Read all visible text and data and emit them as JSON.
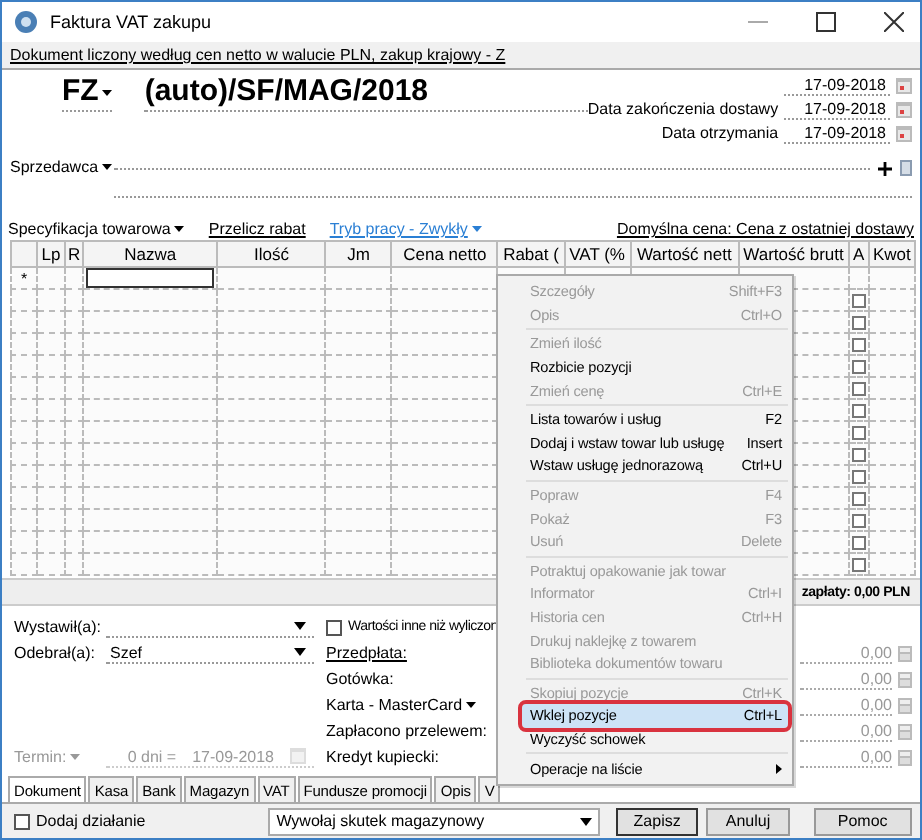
{
  "window": {
    "title": "Faktura VAT zakupu"
  },
  "info_link": "Dokument liczony według cen netto w walucie PLN, zakup krajowy - Z",
  "document": {
    "type": "FZ",
    "number": "(auto)/SF/MAG/2018"
  },
  "dates": [
    {
      "value": "17-09-2018"
    },
    {
      "label": "Data zakończenia dostawy",
      "value": "17-09-2018"
    },
    {
      "label": "Data otrzymania",
      "value": "17-09-2018"
    }
  ],
  "seller": {
    "label": "Sprzedawca"
  },
  "toolbar": [
    {
      "label": "Specyfikacja towarowa",
      "kind": "dropdown"
    },
    {
      "label": "Przelicz rabat",
      "kind": "link"
    },
    {
      "label": "Tryb pracy - Zwykły",
      "kind": "mode"
    }
  ],
  "default_price": "Domyślna cena: Cena z ostatniej dostawy",
  "grid": {
    "columns": [
      {
        "label": "Lp",
        "focused": false
      },
      {
        "label": "R",
        "focused": false
      },
      {
        "label": "Nazwa",
        "focused": true
      },
      {
        "label": "Ilość",
        "focused": false
      },
      {
        "label": "Jm",
        "focused": false
      },
      {
        "label": "Cena netto",
        "focused": false
      },
      {
        "label": "Rabat (",
        "focused": false
      },
      {
        "label": "VAT (%",
        "focused": false
      },
      {
        "label": "Wartość nett",
        "focused": false
      },
      {
        "label": "Wartość brutt",
        "focused": false
      },
      {
        "label": "A",
        "focused": false
      },
      {
        "label": "Kwot",
        "focused": false
      }
    ],
    "new_row_marker": "*",
    "rows": [
      {
        "checked": false
      },
      {
        "checked": false
      },
      {
        "checked": false
      },
      {
        "checked": false
      },
      {
        "checked": false
      },
      {
        "checked": false
      },
      {
        "checked": false
      },
      {
        "checked": false
      },
      {
        "checked": false
      },
      {
        "checked": false
      },
      {
        "checked": false
      },
      {
        "checked": false
      },
      {
        "checked": false
      }
    ]
  },
  "summary": "zapłaty: 0,00 PLN",
  "form": {
    "issued_by": {
      "label": "Wystawił(a):"
    },
    "received_by": {
      "label": "Odebrał(a):",
      "value": "Szef"
    },
    "term": {
      "label": "Termin:",
      "days": "0 dni =",
      "date": "17-09-2018",
      "disabled": true
    },
    "other_values": {
      "label": "Wartości inne niż wyliczon",
      "checked": false
    },
    "payments": [
      {
        "label": "Przedpłata:",
        "kind": "link",
        "amount": "0,00"
      },
      {
        "label": "Gotówka:",
        "kind": "plain",
        "amount": "0,00"
      },
      {
        "label": "Karta - MasterCard",
        "kind": "dropdown",
        "amount": "0,00"
      },
      {
        "label": "Zapłacono przelewem:",
        "kind": "plain",
        "amount": "0,00"
      },
      {
        "label": "Kredyt kupiecki:",
        "kind": "plain",
        "amount": "0,00"
      }
    ]
  },
  "tabs": [
    {
      "label": "Dokument",
      "selected": true
    },
    {
      "label": "Kasa",
      "selected": false
    },
    {
      "label": "Bank",
      "selected": false
    },
    {
      "label": "Magazyn",
      "selected": false
    },
    {
      "label": "VAT",
      "selected": false
    },
    {
      "label": "Fundusze promocji",
      "selected": false
    },
    {
      "label": "Opis",
      "selected": false
    },
    {
      "label": "V",
      "selected": false
    }
  ],
  "bottom": {
    "add_action": {
      "label": "Dodaj działanie",
      "checked": false
    },
    "stock_effect": "Wywołaj skutek magazynowy",
    "buttons": [
      "Zapisz",
      "Anuluj",
      "Pomoc"
    ]
  },
  "context_menu": {
    "items": [
      {
        "kind": "item",
        "label": "Szczegóły",
        "shortcut": "Shift+F3",
        "disabled": true,
        "selected": false
      },
      {
        "kind": "item",
        "label": "Opis",
        "shortcut": "Ctrl+O",
        "disabled": true,
        "selected": false
      },
      {
        "kind": "separator"
      },
      {
        "kind": "item",
        "label": "Zmień ilość",
        "disabled": true,
        "selected": false
      },
      {
        "kind": "item",
        "label": "Rozbicie pozycji",
        "disabled": false,
        "selected": false
      },
      {
        "kind": "item",
        "label": "Zmień cenę",
        "shortcut": "Ctrl+E",
        "disabled": true,
        "selected": false
      },
      {
        "kind": "separator"
      },
      {
        "kind": "item",
        "label": "Lista towarów i usług",
        "shortcut": "F2",
        "disabled": false,
        "selected": false
      },
      {
        "kind": "item",
        "label": "Dodaj i wstaw towar lub usługę",
        "shortcut": "Insert",
        "disabled": false,
        "selected": false
      },
      {
        "kind": "item",
        "label": "Wstaw usługę jednorazową",
        "shortcut": "Ctrl+U",
        "disabled": false,
        "selected": false
      },
      {
        "kind": "separator"
      },
      {
        "kind": "item",
        "label": "Popraw",
        "shortcut": "F4",
        "disabled": true,
        "selected": false
      },
      {
        "kind": "item",
        "label": "Pokaż",
        "shortcut": "F3",
        "disabled": true,
        "selected": false
      },
      {
        "kind": "item",
        "label": "Usuń",
        "shortcut": "Delete",
        "disabled": true,
        "selected": false
      },
      {
        "kind": "separator"
      },
      {
        "kind": "item",
        "label": "Potraktuj opakowanie jak towar",
        "disabled": true,
        "selected": false
      },
      {
        "kind": "item",
        "label": "Informator",
        "shortcut": "Ctrl+I",
        "disabled": true,
        "selected": false
      },
      {
        "kind": "item",
        "label": "Historia cen",
        "shortcut": "Ctrl+H",
        "disabled": true,
        "selected": false
      },
      {
        "kind": "item",
        "label": "Drukuj naklejkę z towarem",
        "disabled": true,
        "selected": false
      },
      {
        "kind": "item",
        "label": "Biblioteka dokumentów towaru",
        "disabled": true,
        "selected": false
      },
      {
        "kind": "separator"
      },
      {
        "kind": "item",
        "label": "Skopiuj pozycje",
        "shortcut": "Ctrl+K",
        "disabled": true,
        "selected": false
      },
      {
        "kind": "item",
        "label": "Wklej pozycje",
        "shortcut": "Ctrl+L",
        "disabled": false,
        "selected": true
      },
      {
        "kind": "item",
        "label": "Wyczyść schowek",
        "disabled": false,
        "selected": false
      },
      {
        "kind": "separator"
      },
      {
        "kind": "submenu",
        "label": "Operacje na liście",
        "disabled": false,
        "selected": false
      }
    ]
  }
}
